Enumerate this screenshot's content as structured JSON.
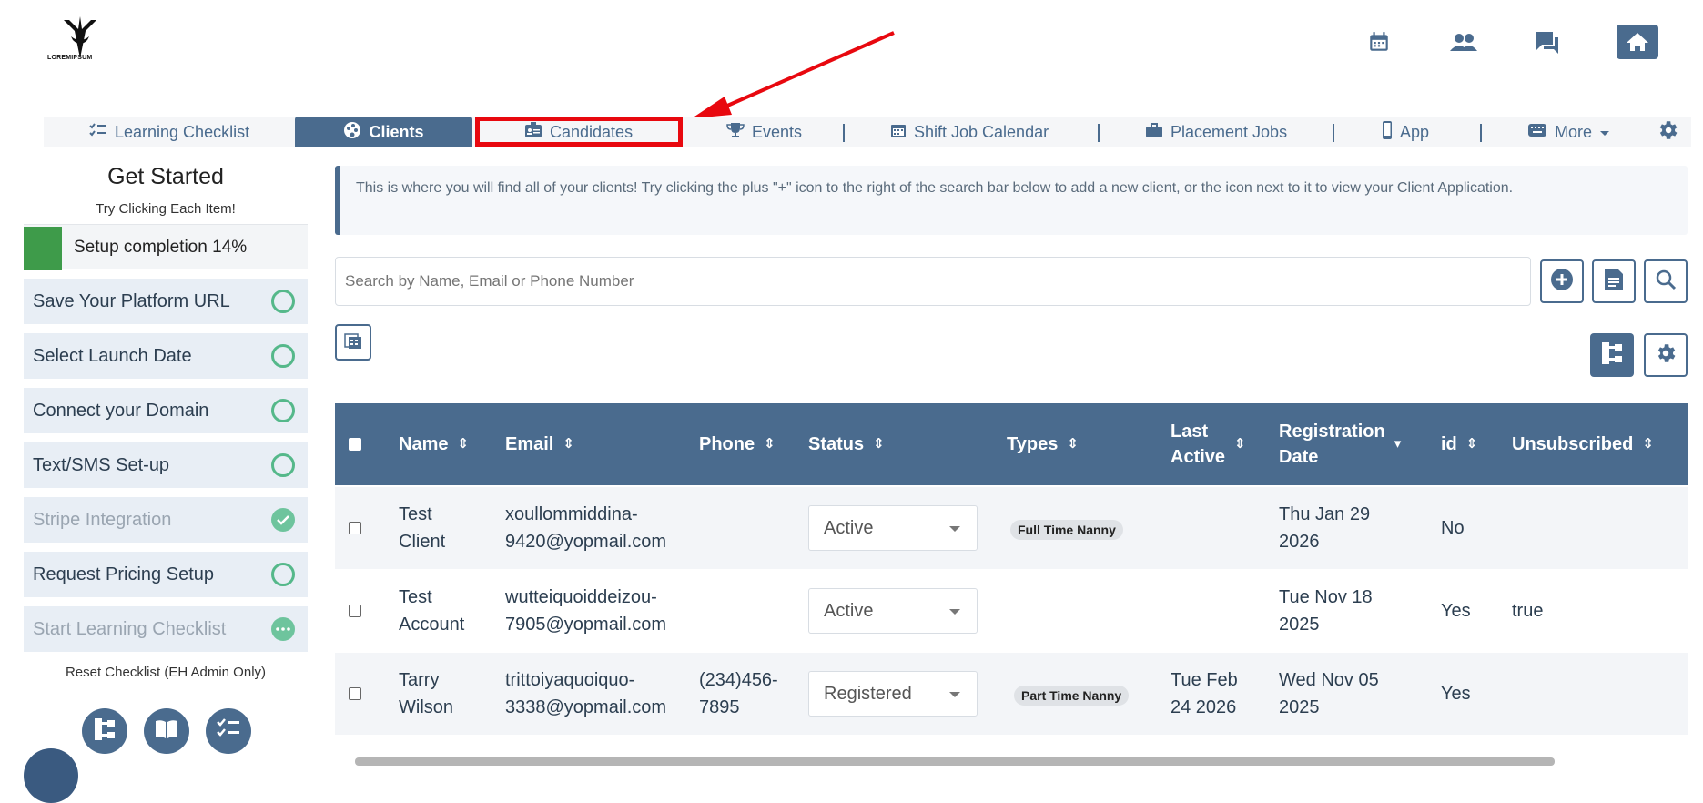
{
  "logo": {
    "text": "LOREMIPSUM"
  },
  "top_icons": [
    "calendar-icon",
    "people-icon",
    "chat-icon",
    "home-icon"
  ],
  "nav": {
    "items": [
      {
        "label": "Learning Checklist",
        "icon": "checklist-icon"
      },
      {
        "label": "Clients",
        "icon": "palette-icon",
        "active": true
      },
      {
        "label": "Candidates",
        "icon": "id-card-icon"
      },
      {
        "label": "Events",
        "icon": "trophy-icon"
      },
      {
        "label": "Shift Job Calendar",
        "icon": "calendar-icon"
      },
      {
        "label": "Placement Jobs",
        "icon": "briefcase-icon"
      },
      {
        "label": "App",
        "icon": "phone-icon"
      },
      {
        "label": "More",
        "icon": "keyboard-icon"
      }
    ]
  },
  "sidebar": {
    "title": "Get Started",
    "subtitle": "Try Clicking Each Item!",
    "progress_label": "Setup completion 14%",
    "progress_value": 14,
    "items": [
      {
        "label": "Save Your Platform URL",
        "state": "todo"
      },
      {
        "label": "Select Launch Date",
        "state": "todo"
      },
      {
        "label": "Connect your Domain",
        "state": "todo"
      },
      {
        "label": "Text/SMS Set-up",
        "state": "todo"
      },
      {
        "label": "Stripe Integration",
        "state": "done"
      },
      {
        "label": "Request Pricing Setup",
        "state": "todo"
      },
      {
        "label": "Start Learning Checklist",
        "state": "in-progress"
      }
    ],
    "reset_label": "Reset Checklist (EH Admin Only)"
  },
  "info": {
    "text": "This is where you will find all of your clients! Try clicking the plus \"+\" icon to the right of the search bar below to add a new client, or the icon next to it to view your Client Application."
  },
  "search": {
    "placeholder": "Search by Name, Email or Phone Number"
  },
  "table": {
    "headers": {
      "name": "Name",
      "email": "Email",
      "phone": "Phone",
      "status": "Status",
      "types": "Types",
      "last_active_1": "Last",
      "last_active_2": "Active",
      "reg_1": "Registration",
      "reg_2": "Date",
      "id": "id",
      "unsubscribed": "Unsubscribed"
    },
    "rows": [
      {
        "name_1": "Test",
        "name_2": "Client",
        "email_1": "xoullommiddina-",
        "email_2": "9420@yopmail.com",
        "phone_1": "",
        "phone_2": "",
        "status": "Active",
        "type": "Full Time Nanny",
        "last_1": "",
        "last_2": "",
        "reg_1": "Thu Jan 29",
        "reg_2": "2026",
        "id": "No",
        "unsub": ""
      },
      {
        "name_1": "Test",
        "name_2": "Account",
        "email_1": "wutteiquoiddeizou-",
        "email_2": "7905@yopmail.com",
        "phone_1": "",
        "phone_2": "",
        "status": "Active",
        "type": "",
        "last_1": "",
        "last_2": "",
        "reg_1": "Tue Nov 18",
        "reg_2": "2025",
        "id": "Yes",
        "unsub": "true"
      },
      {
        "name_1": "Tarry",
        "name_2": "Wilson",
        "email_1": "trittoiyaquoiquo-",
        "email_2": "3338@yopmail.com",
        "phone_1": "(234)456-",
        "phone_2": "7895",
        "status": "Registered",
        "type": "Part Time Nanny",
        "last_1": "Tue Feb",
        "last_2": "24 2026",
        "reg_1": "Wed Nov 05",
        "reg_2": "2025",
        "id": "Yes",
        "unsub": ""
      }
    ]
  },
  "colors": {
    "primary": "#4a6b8e",
    "highlight": "#e8080f",
    "success": "#3e9b4a",
    "check": "#55b88a"
  }
}
